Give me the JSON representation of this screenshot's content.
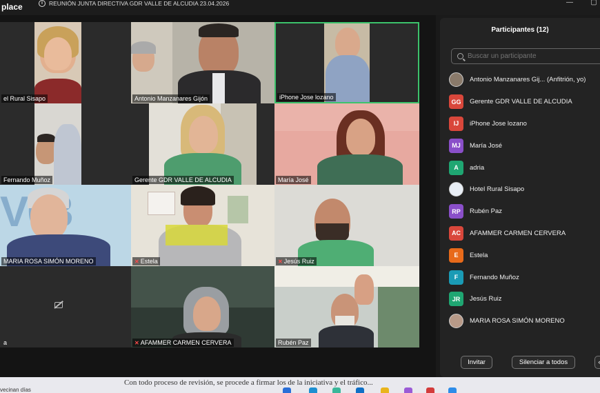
{
  "app": {
    "name": "place"
  },
  "meeting": {
    "title": "REUNIÓN JUNTA DIRECTIVA GDR VALLE DE ALCUDIA 23.04.2026"
  },
  "window_controls": {
    "minimize": "—",
    "maximize": "▢"
  },
  "gallery": {
    "tiles": [
      {
        "label": "el Rural Sisapo",
        "muted": false
      },
      {
        "label": "Antonio Manzanares Gijón",
        "muted": false
      },
      {
        "label": "iPhone Jose lozano",
        "muted": false,
        "active_speaker": true
      },
      {
        "label": "Fernando Muñoz",
        "muted": false
      },
      {
        "label": "Gerente GDR VALLE DE ALCUDIA",
        "muted": false
      },
      {
        "label": "María José",
        "muted": false
      },
      {
        "label": "MARIA ROSA SIMÓN MORENO",
        "muted": false
      },
      {
        "label": "Estela",
        "muted": true
      },
      {
        "label": "Jesús Ruiz",
        "muted": true
      },
      {
        "label": "a",
        "muted": false,
        "video_off": true
      },
      {
        "label": "AFAMMER CARMEN CERVERA",
        "muted": true
      },
      {
        "label": "Rubén Paz",
        "muted": false
      }
    ]
  },
  "participants_panel": {
    "title": "Participantes (12)",
    "search_placeholder": "Buscar un participante",
    "participants": [
      {
        "initials": "",
        "name": "Antonio Manzanares Gij...  (Anfitrión, yo)",
        "color": "#8a7a6a",
        "photo": true
      },
      {
        "initials": "GG",
        "name": "Gerente GDR VALLE DE ALCUDIA",
        "color": "#d9473b"
      },
      {
        "initials": "IJ",
        "name": "iPhone Jose lozano",
        "color": "#d9473b"
      },
      {
        "initials": "MJ",
        "name": "María José",
        "color": "#8a4fc9"
      },
      {
        "initials": "A",
        "name": "adria",
        "color": "#1fa672"
      },
      {
        "initials": "",
        "name": "Hotel Rural Sisapo",
        "color": "#e8eef5",
        "photo": true
      },
      {
        "initials": "RP",
        "name": "Rubén Paz",
        "color": "#8a4fc9"
      },
      {
        "initials": "AC",
        "name": "AFAMMER CARMEN CERVERA",
        "color": "#d9473b"
      },
      {
        "initials": "E",
        "name": "Estela",
        "color": "#e86a1a"
      },
      {
        "initials": "F",
        "name": "Fernando Muñoz",
        "color": "#1a9bb5"
      },
      {
        "initials": "JR",
        "name": "Jesús Ruiz",
        "color": "#1fa672"
      },
      {
        "initials": "",
        "name": "MARIA ROSA SIMÓN MORENO",
        "color": "#b89a88",
        "photo": true
      }
    ],
    "invite_label": "Invitar",
    "mute_all_label": "Silenciar a todos"
  },
  "background_document": {
    "text": "Con todo proceso de revisión, se procede a firmar los de la iniciativa y el tráfico..."
  },
  "taskbar": {
    "weather": "vecinan días"
  }
}
